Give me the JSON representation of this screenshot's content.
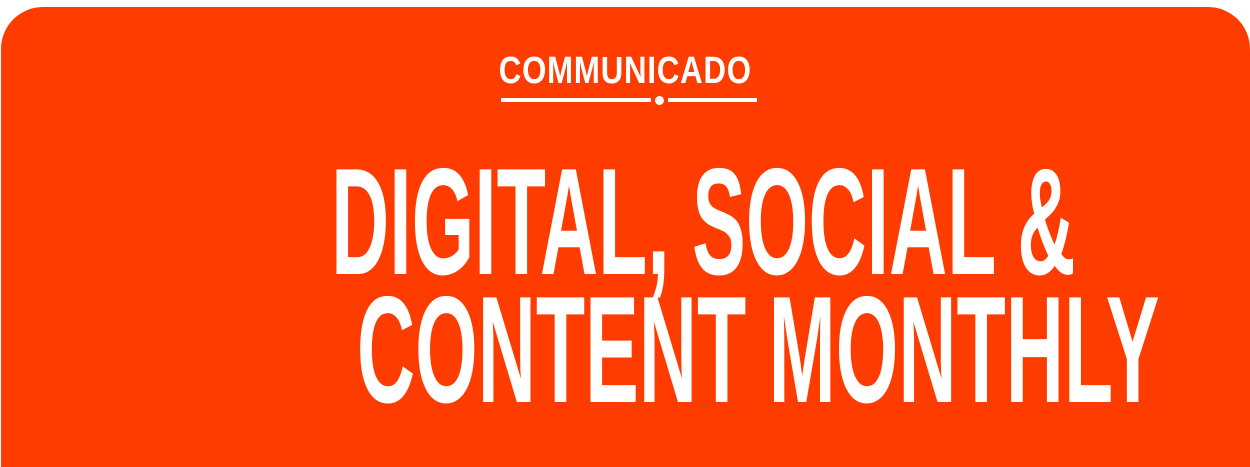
{
  "brand": {
    "logo_text": "COMMUNICADO",
    "color": "#ff3c00"
  },
  "headline": {
    "line1": "DIGITAL, SOCIAL &",
    "line2": "CONTENT MONTHLY"
  }
}
